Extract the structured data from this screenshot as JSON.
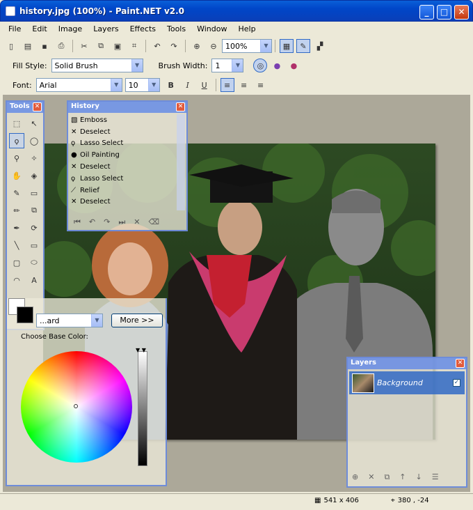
{
  "window": {
    "title": "history.jpg (100%) - Paint.NET v2.0",
    "minimize_glyph": "_",
    "maximize_glyph": "□",
    "close_glyph": "✕"
  },
  "menu": [
    "File",
    "Edit",
    "Image",
    "Layers",
    "Effects",
    "Tools",
    "Window",
    "Help"
  ],
  "toolbar_main": {
    "zoom_value": "100%"
  },
  "toolbar_fill": {
    "fill_style_label": "Fill Style:",
    "fill_style_value": "Solid Brush",
    "brush_width_label": "Brush Width:",
    "brush_width_value": "1"
  },
  "toolbar_text": {
    "font_label": "Font:",
    "font_value": "Arial",
    "size_value": "10",
    "bold": "B",
    "italic": "I",
    "underline": "U"
  },
  "tools_window": {
    "title": "Tools",
    "close_glyph": "✕"
  },
  "history_window": {
    "title": "History",
    "close_glyph": "✕",
    "items": [
      {
        "label": "Emboss",
        "icon": "emboss-icon",
        "glyph": "▧"
      },
      {
        "label": "Deselect",
        "icon": "deselect-icon",
        "glyph": "✕"
      },
      {
        "label": "Lasso Select",
        "icon": "lasso-icon",
        "glyph": "ϙ"
      },
      {
        "label": "Oil Painting",
        "icon": "oil-drop-icon",
        "glyph": "●"
      },
      {
        "label": "Deselect",
        "icon": "deselect-icon",
        "glyph": "✕"
      },
      {
        "label": "Lasso Select",
        "icon": "lasso-icon",
        "glyph": "ϙ"
      },
      {
        "label": "Relief",
        "icon": "relief-icon",
        "glyph": "⟋"
      },
      {
        "label": "Deselect",
        "icon": "deselect-icon",
        "glyph": "✕"
      }
    ]
  },
  "colors_window": {
    "mode_value": "...ard",
    "more_button": "More >>",
    "choose_label": "Choose Base Color:"
  },
  "layers_window": {
    "title": "Layers",
    "close_glyph": "✕",
    "layer_name": "Background",
    "checked_glyph": "✓"
  },
  "status": {
    "image_size": "541 x 406",
    "cursor_pos": "380 , -24"
  }
}
